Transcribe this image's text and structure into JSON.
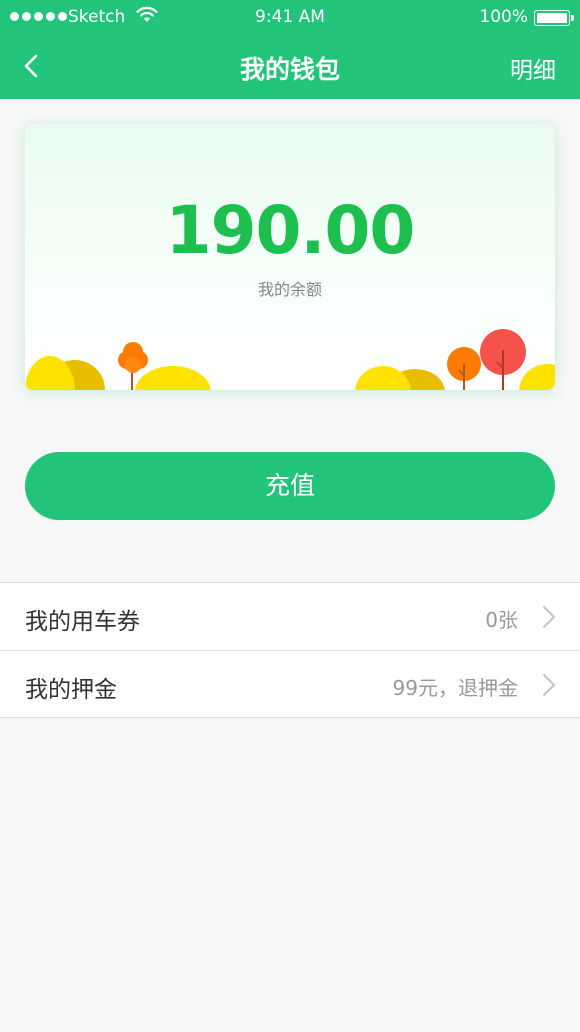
{
  "status_bar": {
    "carrier": "Sketch",
    "time": "9:41 AM",
    "battery": "100%"
  },
  "nav": {
    "back_icon": "chevron-left-icon",
    "title": "我的钱包",
    "detail_label": "明细"
  },
  "card": {
    "balance": "190.00",
    "balance_label": "我的余额"
  },
  "recharge_label": "充值",
  "rows": [
    {
      "label": "我的用车券",
      "value": "0张"
    },
    {
      "label": "我的押金",
      "value": "99元，退押金"
    }
  ],
  "colors": {
    "primary": "#22c47a",
    "balance_text": "#1dc04f",
    "background": "#f7f7f7"
  }
}
